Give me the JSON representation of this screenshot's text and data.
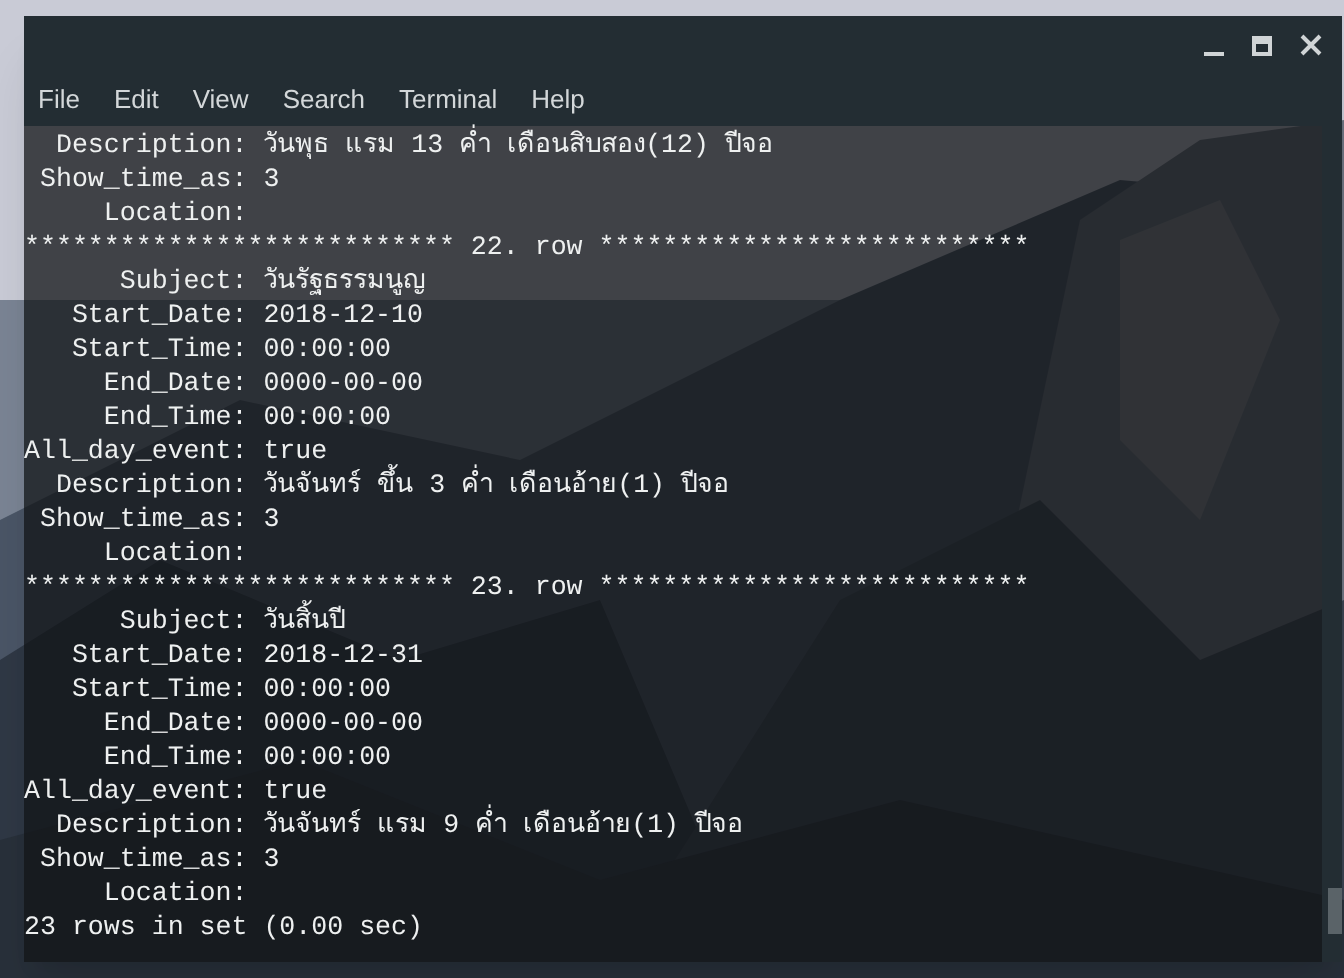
{
  "menu": [
    {
      "label": "File"
    },
    {
      "label": "Edit"
    },
    {
      "label": "View"
    },
    {
      "label": "Search"
    },
    {
      "label": "Terminal"
    },
    {
      "label": "Help"
    }
  ],
  "lines": [
    "  Description: วันพุธ แรม 13 ค่ำ เดือนสิบสอง(12) ปีจอ",
    " Show_time_as: 3",
    "     Location: ",
    "*************************** 22. row ***************************",
    "      Subject: วันรัฐธรรมนูญ",
    "   Start_Date: 2018-12-10",
    "   Start_Time: 00:00:00",
    "     End_Date: 0000-00-00",
    "     End_Time: 00:00:00",
    "All_day_event: true",
    "  Description: วันจันทร์ ขึ้น 3 ค่ำ เดือนอ้าย(1) ปีจอ",
    " Show_time_as: 3",
    "     Location: ",
    "*************************** 23. row ***************************",
    "      Subject: วันสิ้นปี",
    "   Start_Date: 2018-12-31",
    "   Start_Time: 00:00:00",
    "     End_Date: 0000-00-00",
    "     End_Time: 00:00:00",
    "All_day_event: true",
    "  Description: วันจันทร์ แรม 9 ค่ำ เดือนอ้าย(1) ปีจอ",
    " Show_time_as: 3",
    "     Location: ",
    "23 rows in set (0.00 sec)"
  ]
}
